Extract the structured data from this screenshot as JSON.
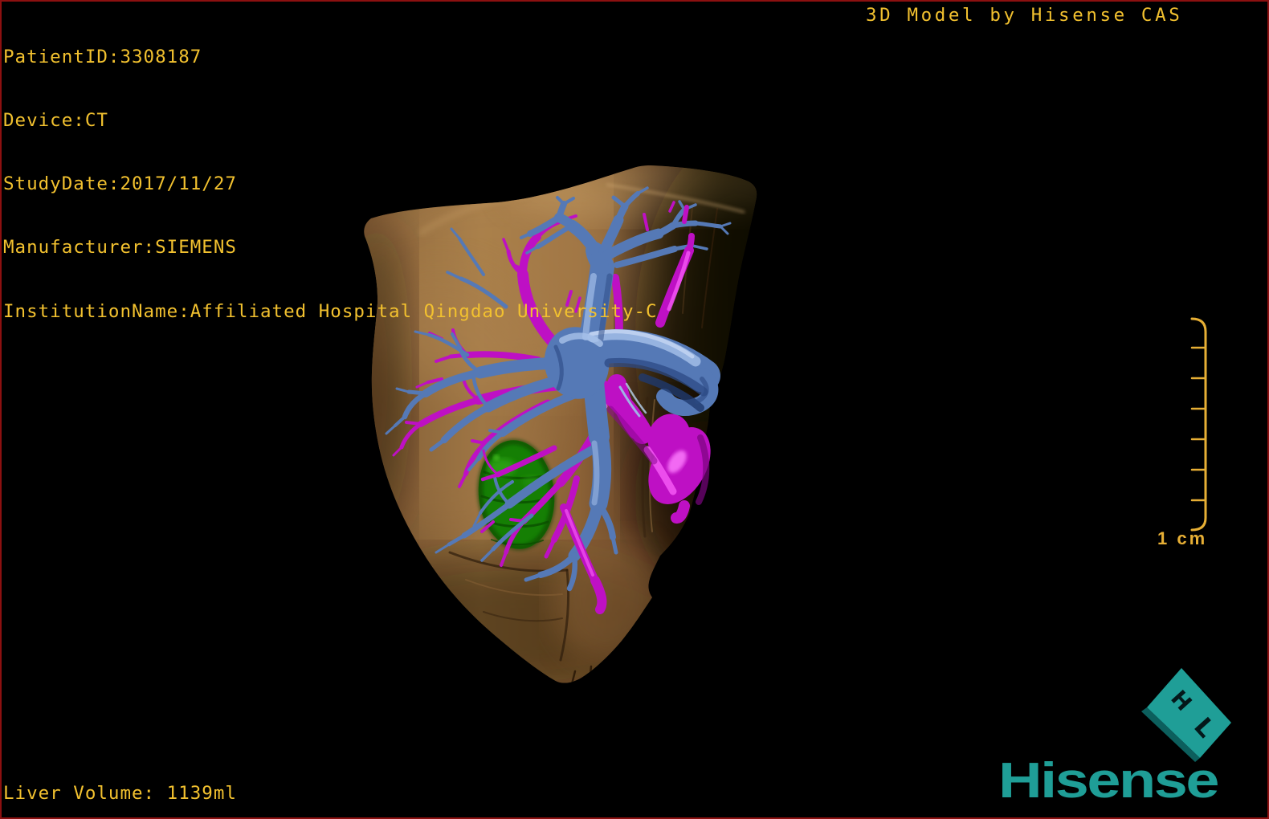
{
  "header": {
    "info_lines": [
      "PatientID:3308187",
      "Device:CT",
      "StudyDate:2017/11/27",
      "Manufacturer:SIEMENS",
      "InstitutionName:Affiliated Hospital Qingdao University-C"
    ],
    "watermark": "3D Model by Hisense CAS"
  },
  "footer": {
    "liver_volume": "Liver Volume: 1139ml"
  },
  "scale_bar": {
    "label": "1 cm"
  },
  "brand": {
    "wordmark": "Hisense",
    "cube_glyph_top": "H",
    "cube_glyph_bottom": "L"
  },
  "colors": {
    "background": "#000000",
    "border_red": "#8C1010",
    "annotation_yellow": "#F2C12F",
    "scale_yellow": "#E7AF35",
    "brand_teal": "#1F9E97",
    "brand_teal_dark": "#0C5F5D",
    "liver_tan": "#9A7242",
    "hepatic_vein_blue": "#5579B6",
    "hepatic_vein_highlight": "#96B3E2",
    "portal_vein_magenta": "#BE10C4",
    "portal_vein_highlight": "#F054F0",
    "tumor_green": "#157F04"
  }
}
